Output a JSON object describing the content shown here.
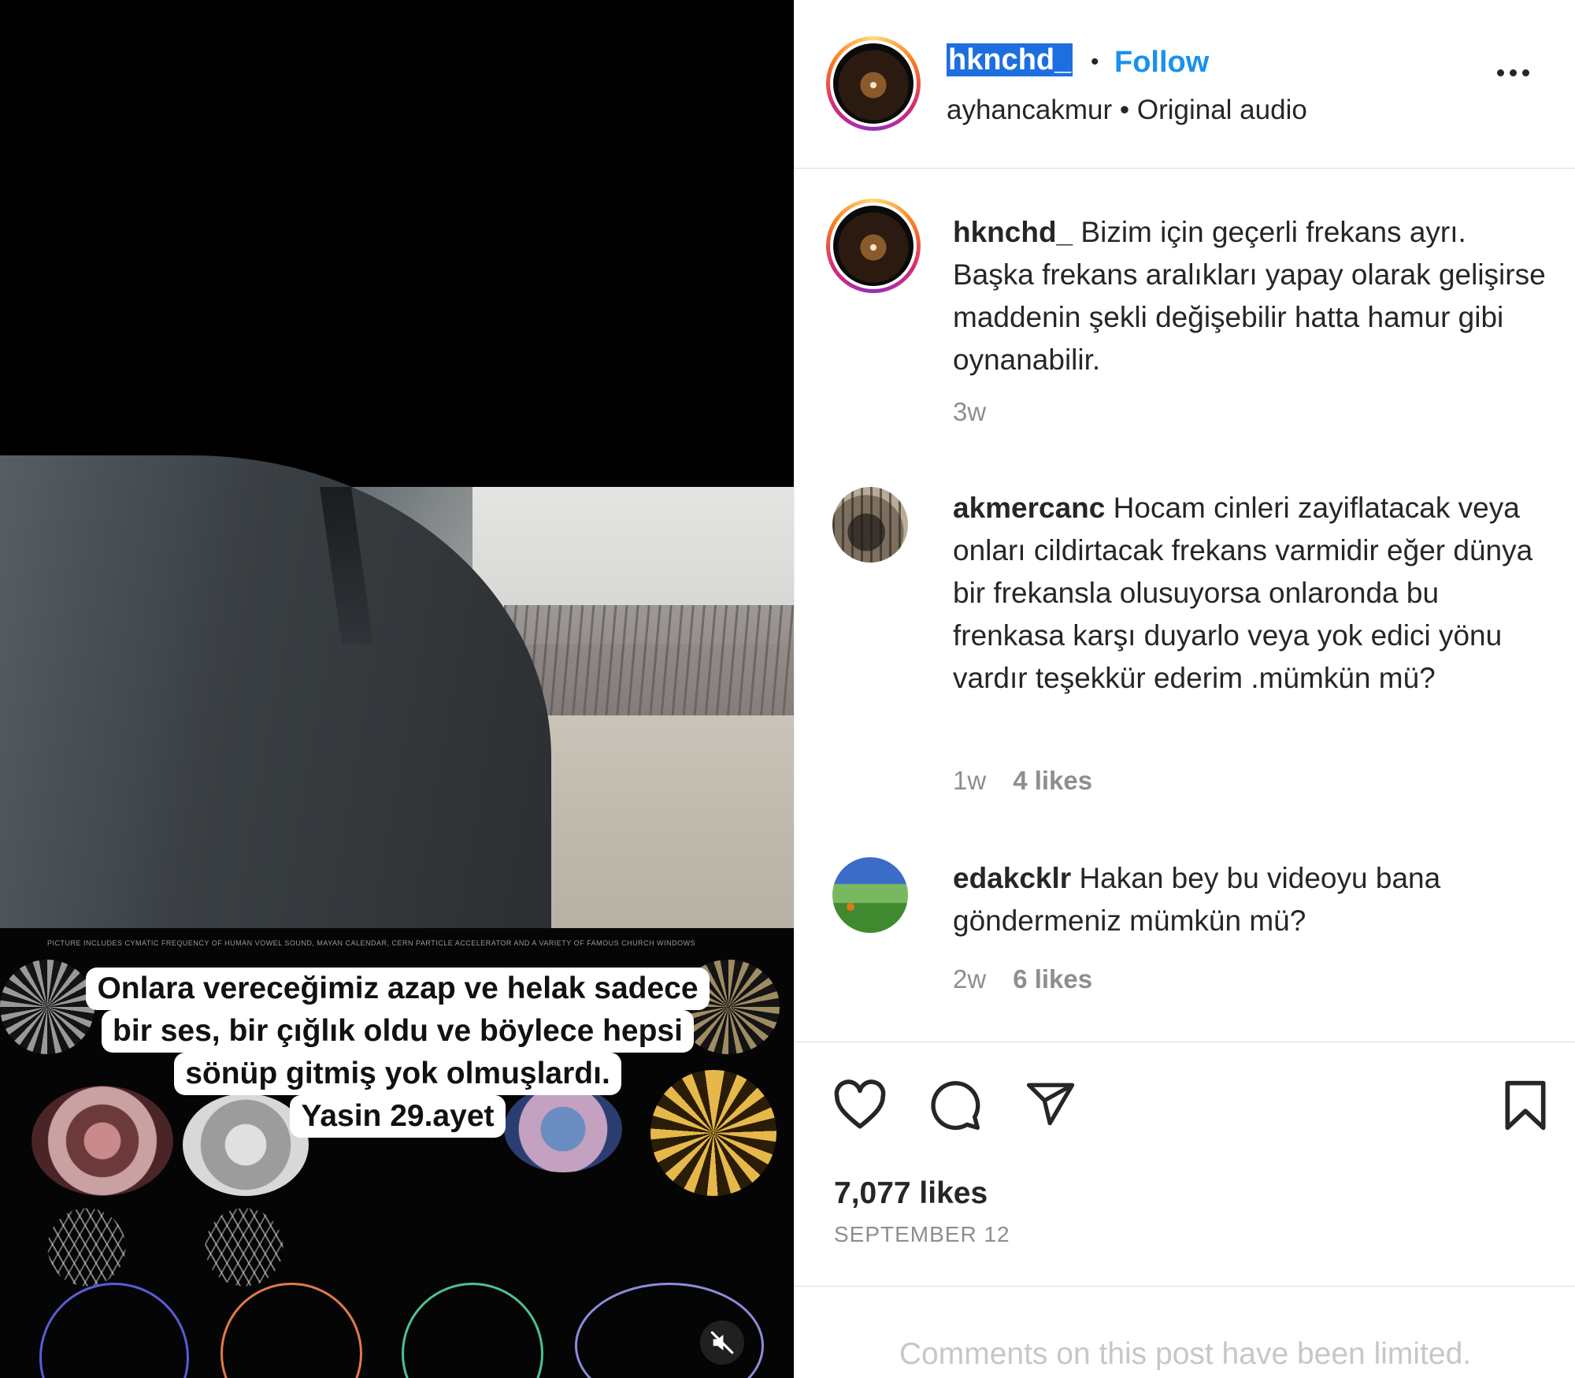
{
  "post": {
    "username": "hknchd_",
    "follow_label": "Follow",
    "audio_owner": "ayhancakmur",
    "audio_label": "Original audio",
    "separator": "•"
  },
  "media": {
    "fine_print": "PICTURE INCLUDES CYMATIC FREQUENCY OF HUMAN VOWEL SOUND, MAYAN CALENDAR, CERN PARTICLE ACCELERATOR AND A VARIETY OF FAMOUS CHURCH WINDOWS",
    "subtitle_lines": [
      "Onlara vereceğimiz azap ve helak sadece",
      "bir ses, bir çığlık oldu ve böylece hepsi",
      "sönüp gitmiş yok olmuşlardı.",
      "Yasin 29.ayet"
    ],
    "mute_icon": "speaker-muted-icon"
  },
  "comments": [
    {
      "username": "hknchd_",
      "text": "Bizim için geçerli frekans ayrı. Başka frekans aralıkları yapay olarak gelişirse maddenin şekli değişebilir hatta hamur gibi oynanabilir.",
      "time": "3w",
      "likes": ""
    },
    {
      "username": "akmercanc",
      "text": "Hocam cinleri zayiflatacak veya onları cildirtacak frekans varmidir eğer dünya bir frekansla olusuyorsa onlaronda bu frenkasa karşı duyarlo veya yok edici yönu vardır teşekkür ederim .mümkün mü?",
      "time": "1w",
      "likes": "4 likes"
    },
    {
      "username": "edakcklr",
      "text": "Hakan bey bu videoyu bana göndermeniz mümkün mü?",
      "time": "2w",
      "likes": "6 likes"
    }
  ],
  "actions": {
    "like_icon": "heart-icon",
    "comment_icon": "comment-bubble-icon",
    "share_icon": "paper-plane-icon",
    "save_icon": "bookmark-icon",
    "likes_count": "7,077 likes",
    "date": "SEPTEMBER 12"
  },
  "footer": {
    "limited_text": "Comments on this post have been limited."
  },
  "colors": {
    "follow": "#1a91ee",
    "muted_text": "#8e8e8e",
    "selection": "#1d6fe0"
  }
}
